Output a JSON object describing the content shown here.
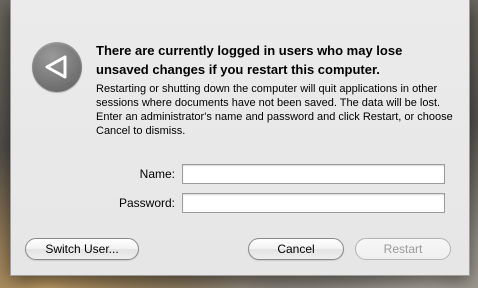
{
  "dialog": {
    "title": "There are currently logged in users who may lose unsaved changes if you restart this computer.",
    "message": "Restarting or shutting down the computer will quit applications in other sessions where documents have not been saved. The data will be lost. Enter an administrator's name and password and click Restart, or choose Cancel to dismiss.",
    "icon": "alert-triangle-icon"
  },
  "form": {
    "name_label": "Name:",
    "name_value": "",
    "password_label": "Password:",
    "password_value": ""
  },
  "buttons": {
    "switch_user": "Switch User...",
    "cancel": "Cancel",
    "restart": "Restart"
  }
}
